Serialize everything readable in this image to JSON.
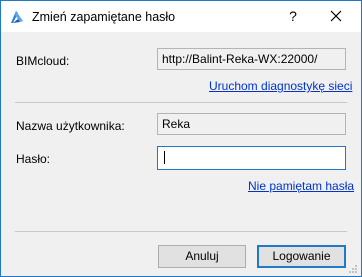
{
  "window": {
    "title": "Zmień zapamiętane hasło",
    "help_label": "?",
    "icon": "bimcloud-app-icon",
    "accent_color": "#1f78c8"
  },
  "server": {
    "label": "BIMcloud:",
    "value": "http://Balint-Reka-WX:22000/",
    "diagnostics_link": "Uruchom diagnostykę sieci"
  },
  "user": {
    "username_label": "Nazwa użytkownika:",
    "username_value": "Reka",
    "password_label": "Hasło:",
    "password_value": "",
    "forgot_link": "Nie pamiętam hasła"
  },
  "buttons": {
    "cancel": "Anuluj",
    "login": "Logowanie"
  }
}
